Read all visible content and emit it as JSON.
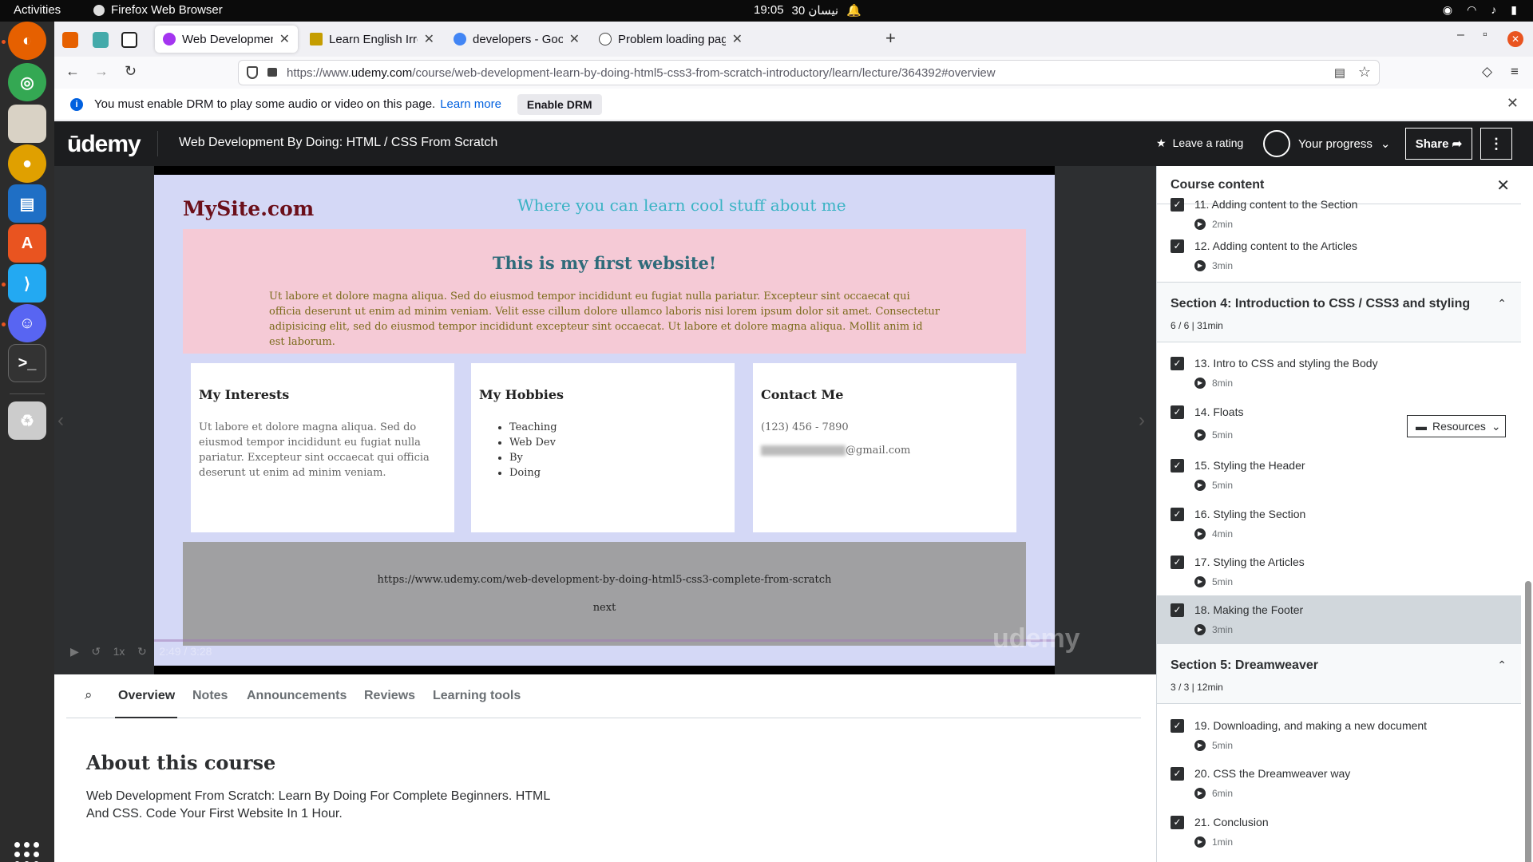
{
  "system": {
    "activities": "Activities",
    "app_name": "Firefox Web Browser",
    "time": "19:05",
    "date": "30 نيسان"
  },
  "browser": {
    "tabs": [
      {
        "title": "Web Development By Do",
        "active": true
      },
      {
        "title": "Learn English Irregular V",
        "active": false
      },
      {
        "title": "developers - Google Sear",
        "active": false
      },
      {
        "title": "Problem loading page",
        "active": false
      }
    ],
    "url_prefix": "https://www.",
    "url_domain": "udemy.com",
    "url_path": "/course/web-development-learn-by-doing-html5-css3-from-scratch-introductory/learn/lecture/364392#overview",
    "drm_message": "You must enable DRM to play some audio or video on this page.",
    "drm_learn_more": "Learn more",
    "drm_button": "Enable DRM"
  },
  "udemy": {
    "logo": "ūdemy",
    "course_title": "Web Development By Doing: HTML / CSS From Scratch",
    "leave_rating": "Leave a rating",
    "progress_label": "Your progress",
    "share": "Share",
    "more": "⋮"
  },
  "video": {
    "site_logo": "MySite.com",
    "site_tagline": "Where you can learn cool stuff about me",
    "hero_title": "This is my first website!",
    "hero_text": "Ut labore et dolore magna aliqua. Sed do eiusmod tempor incididunt eu fugiat nulla pariatur. Excepteur sint occaecat qui officia deserunt ut enim ad minim veniam. Velit esse cillum dolore ullamco laboris nisi lorem ipsum dolor sit amet. Consectetur adipisicing elit, sed do eiusmod tempor incididunt excepteur sint occaecat. Ut labore et dolore magna aliqua. Mollit anim id est laborum.",
    "interests_title": "My Interests",
    "interests_text": "Ut labore et dolore magna aliqua. Sed do eiusmod tempor incididunt eu fugiat nulla pariatur. Excepteur sint occaecat qui officia deserunt ut enim ad minim veniam.",
    "hobbies_title": "My Hobbies",
    "hobbies": [
      "Teaching",
      "Web Dev",
      "By",
      "Doing"
    ],
    "contact_title": "Contact Me",
    "contact_phone": "(123) 456 - 7890",
    "contact_email_suffix": "@gmail.com",
    "footer_link": "https://www.udemy.com/web-development-by-doing-html5-css3-complete-from-scratch",
    "footer_next": "next",
    "time_display": "2:49 / 3:28",
    "speed": "1x",
    "watermark": "udemy"
  },
  "lecture_tabs": {
    "items": [
      "Overview",
      "Notes",
      "Announcements",
      "Reviews",
      "Learning tools"
    ],
    "active": "Overview",
    "about_title": "About this course",
    "about_text": "Web Development From Scratch: Learn By Doing For Complete Beginners. HTML And CSS. Code Your First Website In 1 Hour."
  },
  "sidebar": {
    "title": "Course content",
    "items_top": [
      {
        "name": "11. Adding content to the Section",
        "duration": "2min"
      },
      {
        "name": "12. Adding content to the Articles",
        "duration": "3min"
      }
    ],
    "section4": {
      "title": "Section 4: Introduction to CSS / CSS3 and styling",
      "meta": "6 / 6 | 31min"
    },
    "section4_items": [
      {
        "name": "13. Intro to CSS and styling the Body",
        "duration": "8min"
      },
      {
        "name": "14. Floats",
        "duration": "5min"
      },
      {
        "name": "15. Styling the Header",
        "duration": "5min"
      },
      {
        "name": "16. Styling the Section",
        "duration": "4min"
      },
      {
        "name": "17. Styling the Articles",
        "duration": "5min"
      },
      {
        "name": "18. Making the Footer",
        "duration": "3min"
      }
    ],
    "resources_label": "Resources",
    "section5": {
      "title": "Section 5: Dreamweaver",
      "meta": "3 / 3 | 12min"
    },
    "section5_items": [
      {
        "name": "19. Downloading, and making a new document",
        "duration": "5min"
      },
      {
        "name": "20. CSS the Dreamweaver way",
        "duration": "6min"
      },
      {
        "name": "21. Conclusion",
        "duration": "1min"
      }
    ]
  },
  "colors": {
    "accent": "#e95420",
    "udemy_dark": "#1c1d1f",
    "link_blue": "#0060df"
  }
}
